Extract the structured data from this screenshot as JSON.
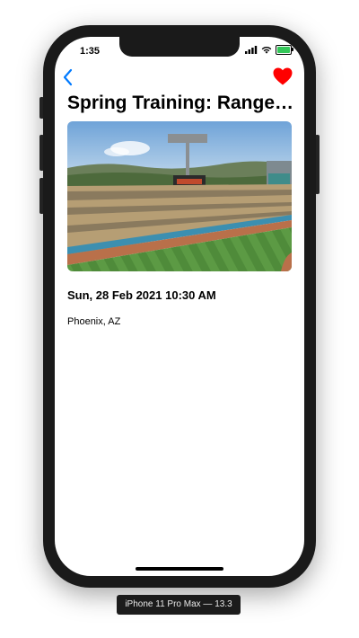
{
  "status_bar": {
    "time": "1:35",
    "icons": [
      "cellular-signal-icon",
      "wifi-icon",
      "battery-icon"
    ],
    "battery_color": "#34c759"
  },
  "nav": {
    "back_icon": "chevron-left-icon",
    "favorite_icon": "heart-icon",
    "accent_color": "#007aff",
    "favorite_color": "#ff0000"
  },
  "event": {
    "title": "Spring Training: Rangers vs Giants",
    "image": "stadium-photo",
    "datetime": "Sun, 28 Feb 2021 10:30 AM",
    "location": "Phoenix, AZ"
  },
  "simulator": {
    "device_label": "iPhone 11 Pro Max — 13.3"
  }
}
